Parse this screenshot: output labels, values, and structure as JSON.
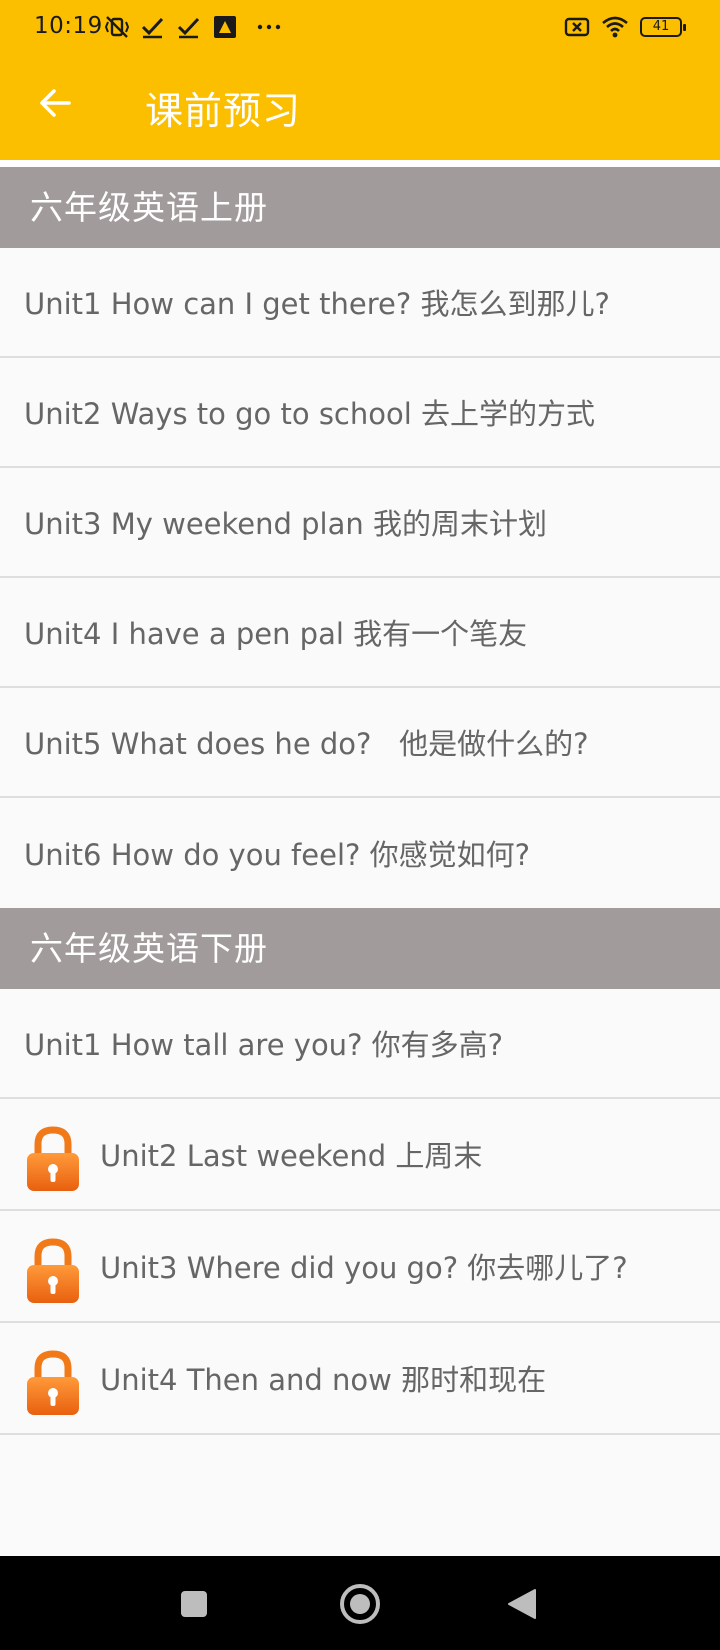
{
  "status_bar": {
    "time": "10:19",
    "left_icons": [
      "mute-vibrate-icon",
      "check-icon",
      "check-icon",
      "app-icon",
      "more-dots-icon"
    ],
    "right_icons": [
      "sim-none-icon",
      "wifi-icon"
    ],
    "battery": "41"
  },
  "app_bar": {
    "title": "课前预习",
    "background": "#fbbf00"
  },
  "sections": [
    {
      "header": "六年级英语上册",
      "items": [
        {
          "label": "Unit1 How can I get there? 我怎么到那儿?",
          "locked": false
        },
        {
          "label": "Unit2 Ways to go to school 去上学的方式",
          "locked": false
        },
        {
          "label": "Unit3 My weekend plan 我的周末计划",
          "locked": false
        },
        {
          "label": "Unit4 I have a pen pal 我有一个笔友",
          "locked": false
        },
        {
          "label": "Unit5 What does he do?   他是做什么的?",
          "locked": false
        },
        {
          "label": "Unit6 How do you feel? 你感觉如何?",
          "locked": false
        }
      ]
    },
    {
      "header": "六年级英语下册",
      "items": [
        {
          "label": "Unit1 How tall are you? 你有多高?",
          "locked": false
        },
        {
          "label": "Unit2 Last weekend 上周末",
          "locked": true
        },
        {
          "label": "Unit3 Where did you go? 你去哪儿了?",
          "locked": true
        },
        {
          "label": "Unit4 Then and now 那时和现在",
          "locked": true
        }
      ]
    }
  ],
  "colors": {
    "section_header_bg": "#a29b9b",
    "lock_orange": "#f07a1a"
  },
  "nav_bar": {
    "buttons": [
      "recents-square-icon",
      "home-circle-icon",
      "back-triangle-icon"
    ]
  }
}
